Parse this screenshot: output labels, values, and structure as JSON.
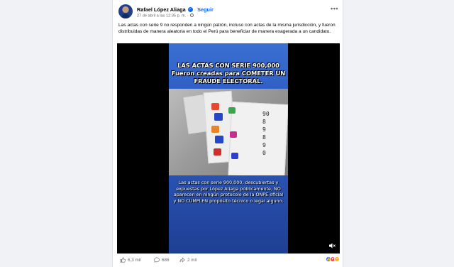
{
  "post": {
    "author": "Rafael López Aliaga",
    "follow_label": "Seguir",
    "date": "27 de abril a las 12:35 p. m.",
    "caption": "Las actas con serie 9 no responden a ningún patrón, incluso con actas de la misma jurisdicción, y fueron distribuidas de manera aleatoria en todo el Perú para beneficiar de manera exagerada a un candidato."
  },
  "video": {
    "top_text": "LAS ACTAS CON SERIE 900,000 Fueron creadas para COMETER UN FRAUDE ELECTORAL.",
    "bottom_text": "Las actas con serie 900,000, descubiertas y expuestas por López Aliaga públicamente, NO aparecen en ningún protocolo de la ONPE oficial y NO CUMPLEN propósito técnico o legal alguno.",
    "numbers": [
      "90",
      "8",
      "9",
      "8",
      "9",
      "0"
    ]
  },
  "footer": {
    "likes": "6,3 mil",
    "comments": "686",
    "shares": "2 mil"
  },
  "colors": {
    "accent": "#0866ff",
    "muted_text": "#65676b"
  },
  "icons": [
    "verified-badge-icon",
    "globe-icon",
    "more-options-icon",
    "mute-icon",
    "like-icon",
    "comment-icon",
    "share-icon"
  ]
}
